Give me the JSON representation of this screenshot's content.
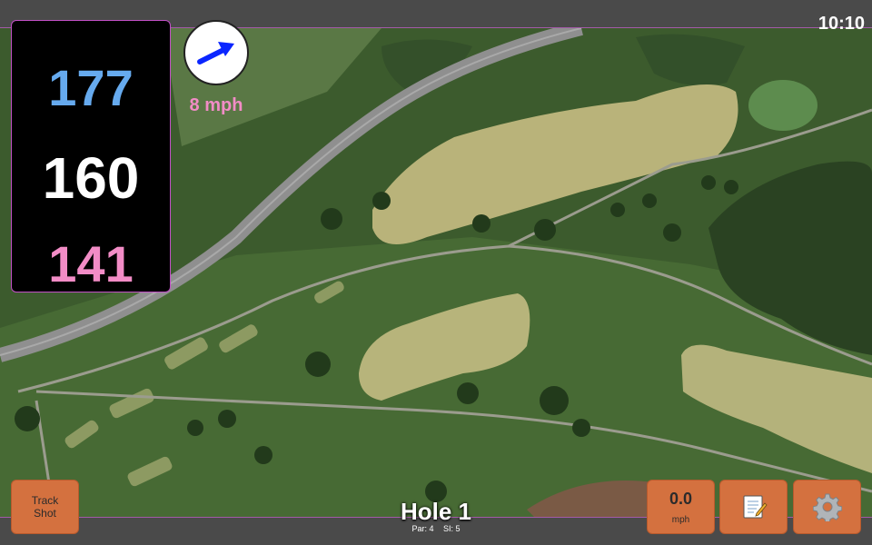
{
  "status_bar": {
    "time": "10:10"
  },
  "distances": {
    "back": {
      "value": "177",
      "color": "#66aaee"
    },
    "center": {
      "value": "160",
      "color": "#ffffff"
    },
    "front": {
      "value": "141",
      "color": "#f28cc6"
    }
  },
  "wind": {
    "speed_label": "8 mph",
    "speed_color": "#f28cc6",
    "direction_icon": "arrow-right-up",
    "arrow_color": "#0b26ff"
  },
  "buttons": {
    "track_shot": "Track\nShot",
    "wind_value": "0.0",
    "wind_unit": "mph",
    "notes_icon": "notepad-icon",
    "settings_icon": "gear-icon"
  },
  "hole": {
    "title": "Hole 1",
    "par": "Par: 4",
    "si": "SI: 5"
  },
  "colors": {
    "button_bg": "#d4713f",
    "panel_border": "#c24fc6",
    "bar_bg": "#4a4a4a"
  }
}
